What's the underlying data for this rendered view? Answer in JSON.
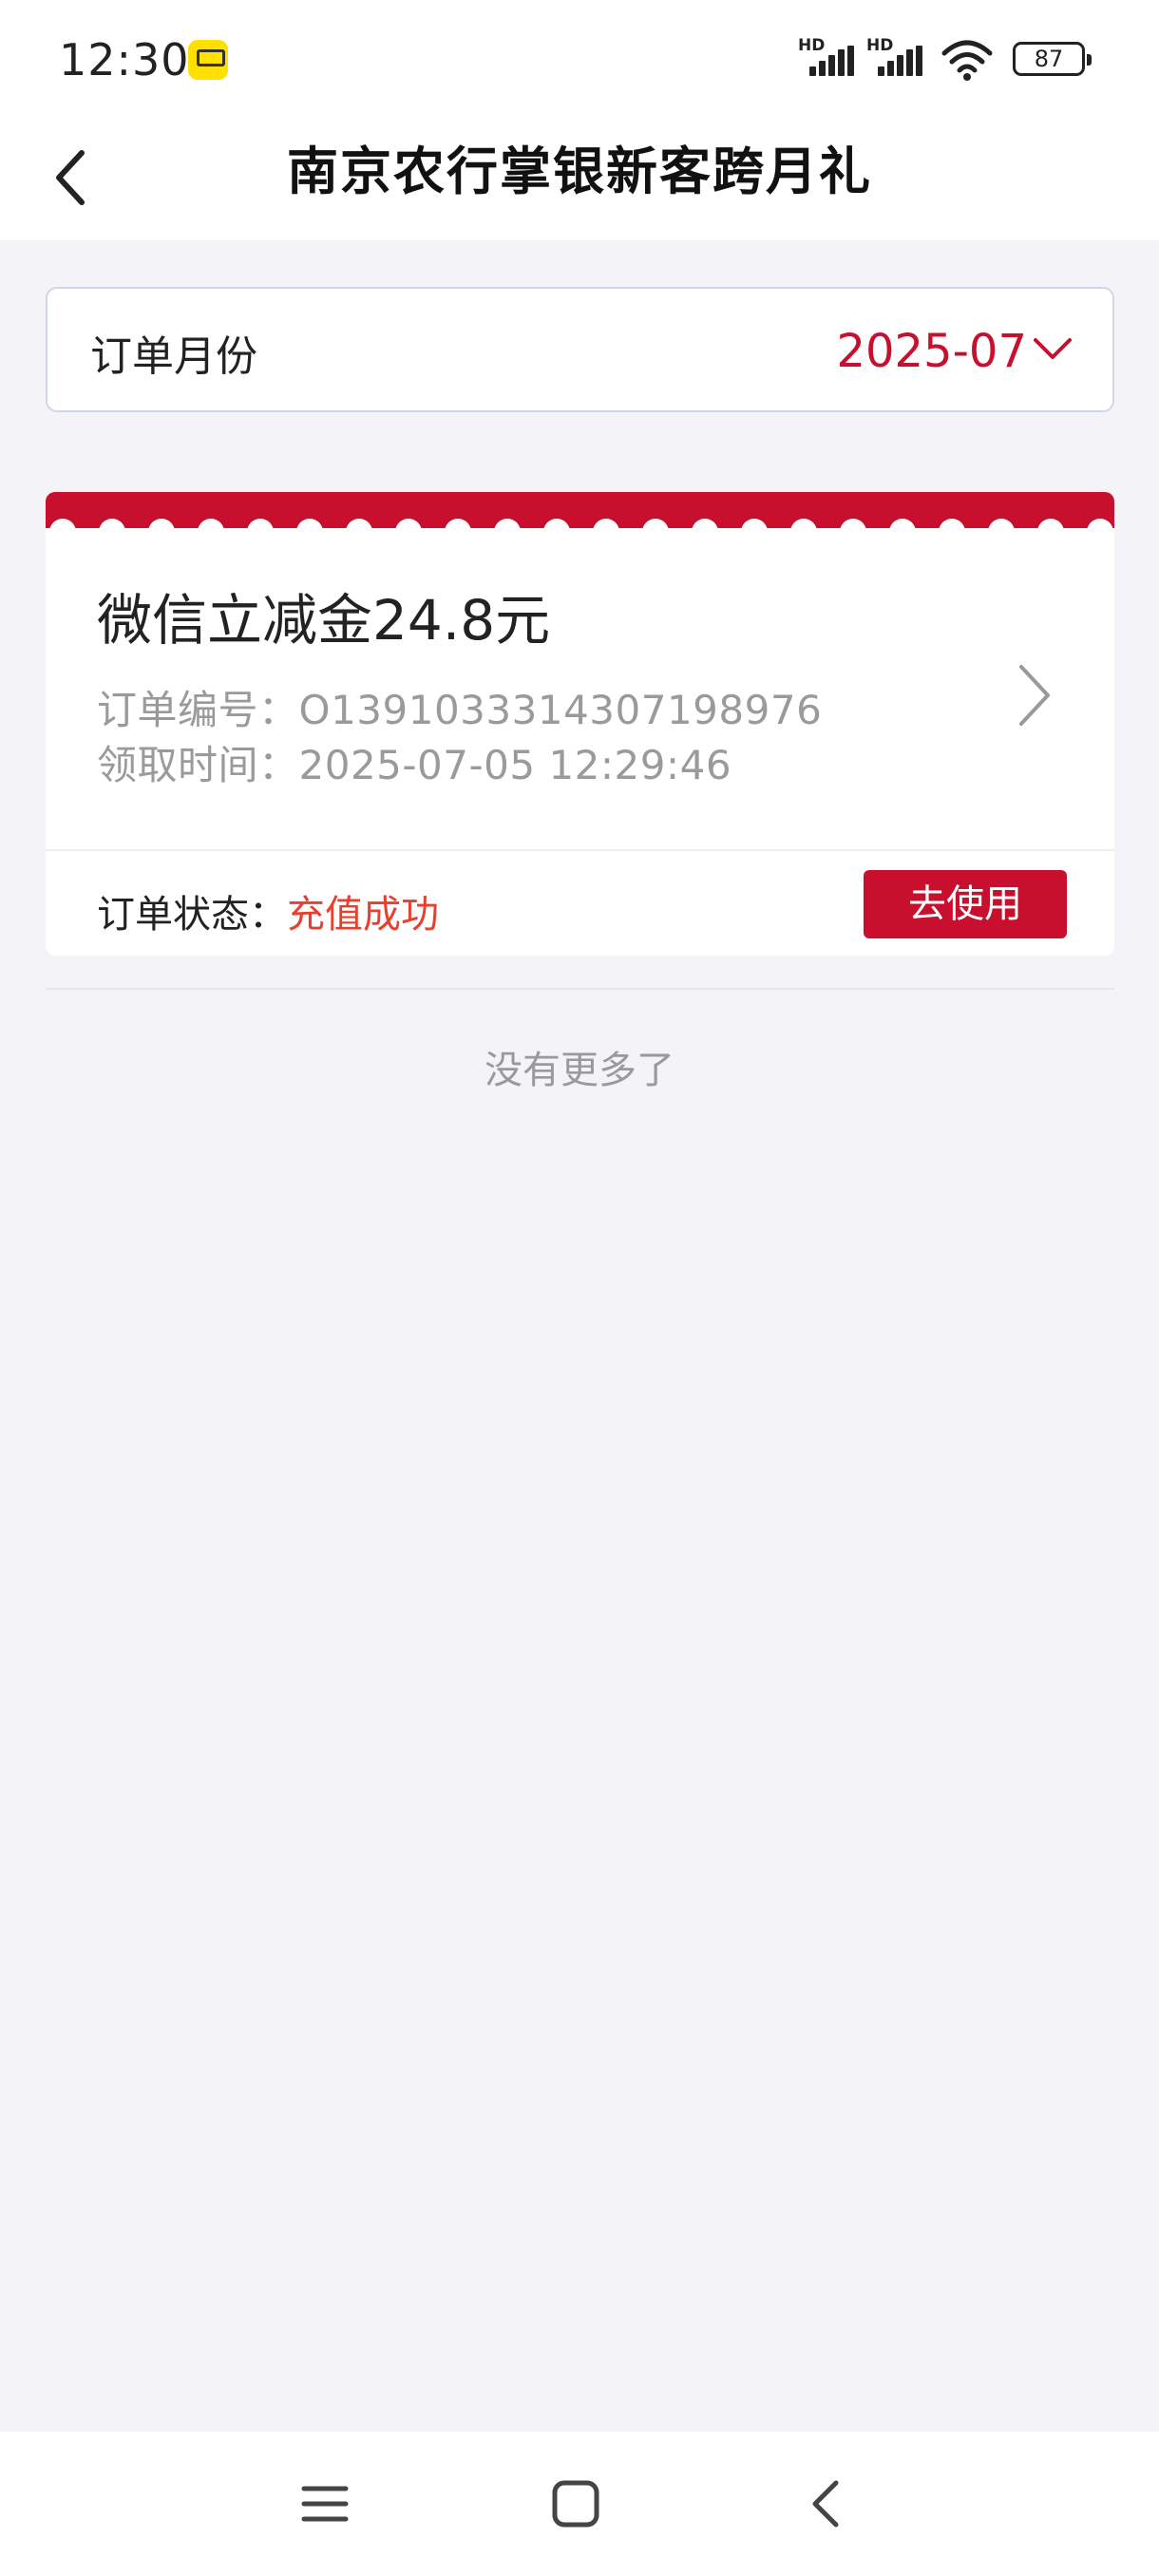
{
  "status_bar": {
    "time": "12:30",
    "battery": "87",
    "signal_1_label": "HD",
    "signal_2_label": "HD"
  },
  "header": {
    "title": "南京农行掌银新客跨月礼"
  },
  "month_filter": {
    "label": "订单月份",
    "value": "2025-07"
  },
  "order": {
    "title": "微信立减金24.8元",
    "order_no_label": "订单编号：",
    "order_no": "O1391033314307198976",
    "claim_time_label": "领取时间：",
    "claim_time": "2025-07-05 12:29:46",
    "status_label": "订单状态：",
    "status_value": "充值成功",
    "use_button": "去使用"
  },
  "list_footer": "没有更多了",
  "colors": {
    "brand_red": "#c8102e",
    "status_red": "#e8402f",
    "page_bg": "#f3f3f8"
  },
  "icons": [
    "app-badge-icon",
    "signal-icon",
    "wifi-icon",
    "battery-icon",
    "back-arrow-icon",
    "chevron-down-icon",
    "chevron-right-icon",
    "menu-icon",
    "home-icon",
    "system-back-icon"
  ]
}
